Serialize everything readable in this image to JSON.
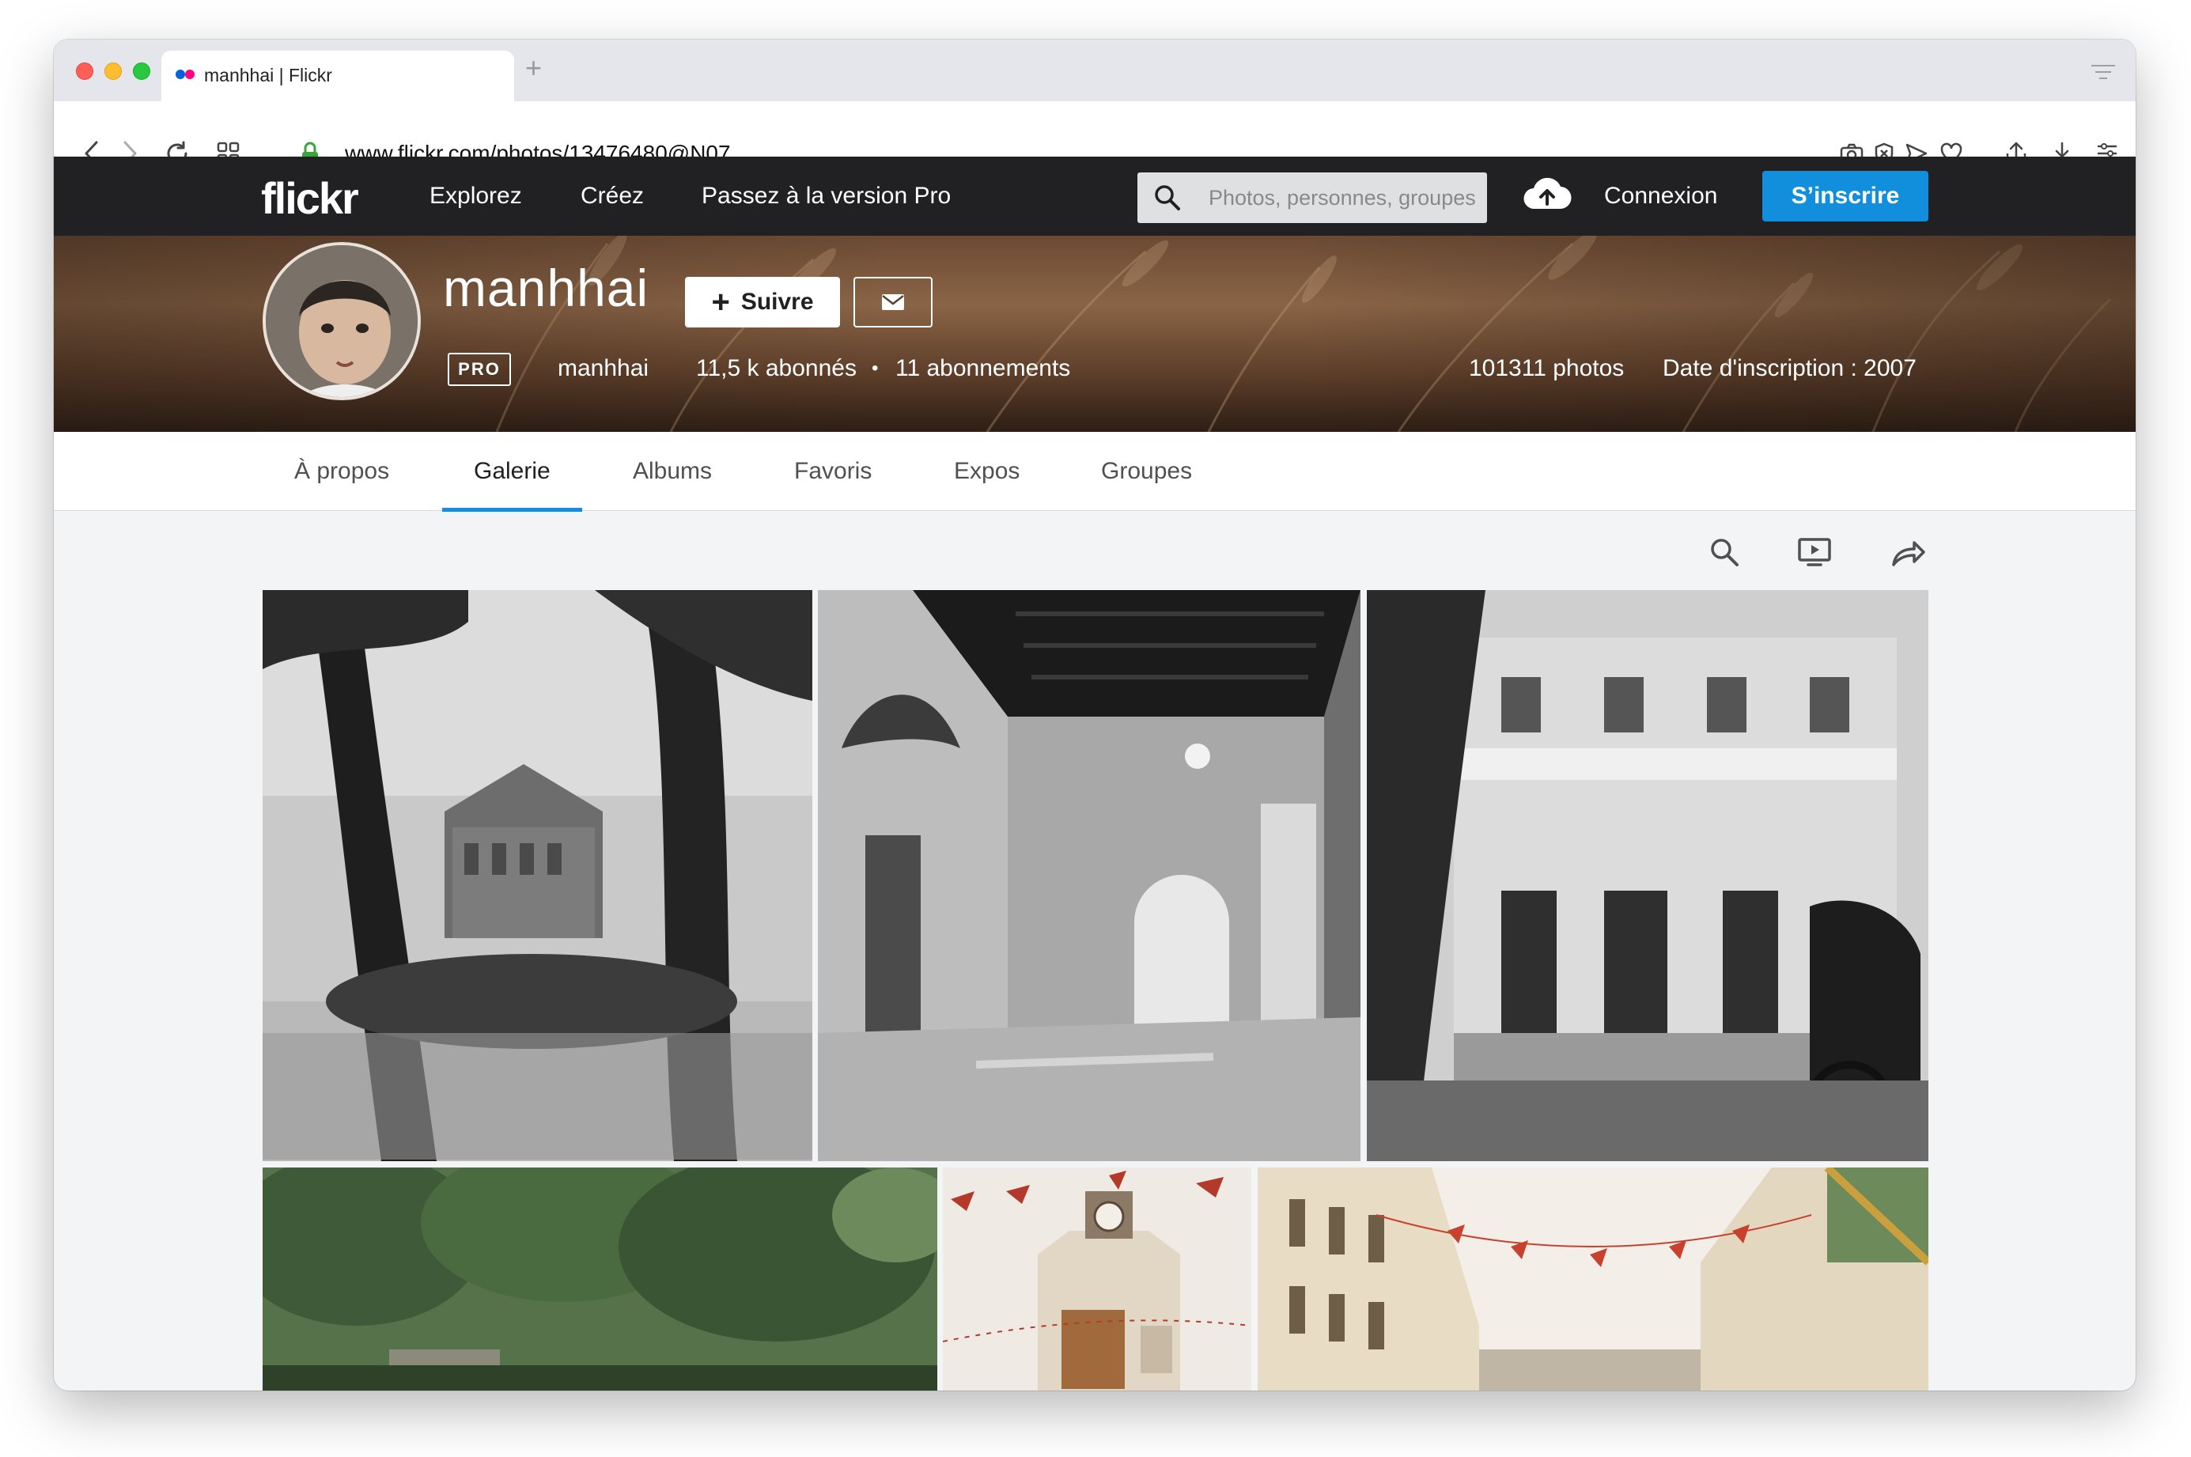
{
  "browser": {
    "tab_title": "manhhai | Flickr",
    "new_tab_glyph": "+",
    "url": "www.flickr.com/photos/13476480@N07"
  },
  "nav": {
    "logo": "flickr",
    "links": [
      "Explorez",
      "Créez",
      "Passez à la version Pro"
    ],
    "search_placeholder": "Photos, personnes, groupes",
    "login": "Connexion",
    "signup": "S’inscrire"
  },
  "profile": {
    "display_name": "manhhai",
    "follow_label": "Suivre",
    "pro_badge": "PRO",
    "username": "manhhai",
    "followers": "11,5 k abonnés",
    "separator": "•",
    "following": "11 abonnements",
    "photo_count": "101311 photos",
    "joined": "Date d'inscription : 2007"
  },
  "subnav": {
    "tabs": [
      "À propos",
      "Galerie",
      "Albums",
      "Favoris",
      "Expos",
      "Groupes"
    ],
    "active": "Galerie"
  },
  "colors": {
    "accent_blue": "#128fdc",
    "nav_background": "#212124",
    "flickr_blue": "#0063dc",
    "flickr_pink": "#ff0084"
  },
  "icons": {
    "toolbar": [
      "back-icon",
      "forward-icon",
      "reload-icon",
      "grid-icon",
      "lock-icon",
      "camera-icon",
      "shield-icon",
      "send-icon",
      "heart-icon",
      "share-icon",
      "download-icon",
      "menu-icon"
    ],
    "gallery_tools": [
      "search-icon",
      "slideshow-icon",
      "share-arrow-icon"
    ]
  }
}
